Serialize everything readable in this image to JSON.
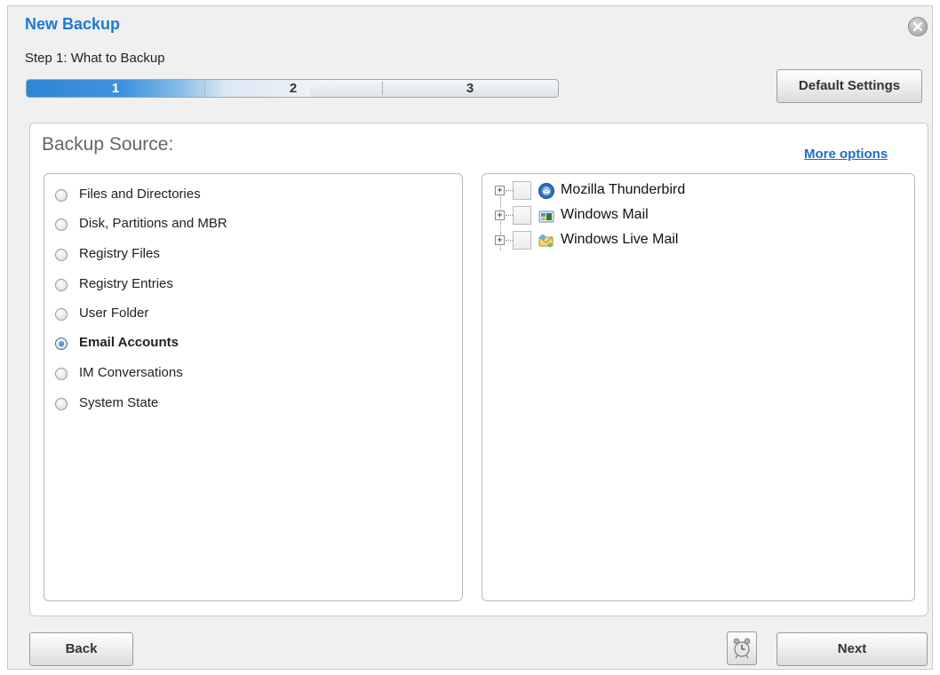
{
  "dialog": {
    "title": "New Backup",
    "step_label": "Step 1: What to Backup",
    "progress": {
      "steps": [
        "1",
        "2",
        "3"
      ],
      "current_step": 1
    },
    "default_settings_label": "Default Settings"
  },
  "source": {
    "title": "Backup Source:",
    "more_options_label": "More options",
    "options": [
      {
        "label": "Files and Directories",
        "selected": false
      },
      {
        "label": "Disk, Partitions and MBR",
        "selected": false
      },
      {
        "label": "Registry Files",
        "selected": false
      },
      {
        "label": "Registry Entries",
        "selected": false
      },
      {
        "label": "User Folder",
        "selected": false
      },
      {
        "label": "Email Accounts",
        "selected": true
      },
      {
        "label": "IM Conversations",
        "selected": false
      },
      {
        "label": "System State",
        "selected": false
      }
    ],
    "email_tree": [
      {
        "label": "Mozilla Thunderbird",
        "icon": "thunderbird-icon",
        "checked": false
      },
      {
        "label": "Windows Mail",
        "icon": "windows-mail-icon",
        "checked": false
      },
      {
        "label": "Windows Live Mail",
        "icon": "windows-live-mail-icon",
        "checked": false
      }
    ]
  },
  "footer": {
    "back_label": "Back",
    "next_label": "Next"
  },
  "colors": {
    "title": "#1a7ad4",
    "link": "#1a6fd0",
    "progress_fill": "#2f84d4"
  }
}
